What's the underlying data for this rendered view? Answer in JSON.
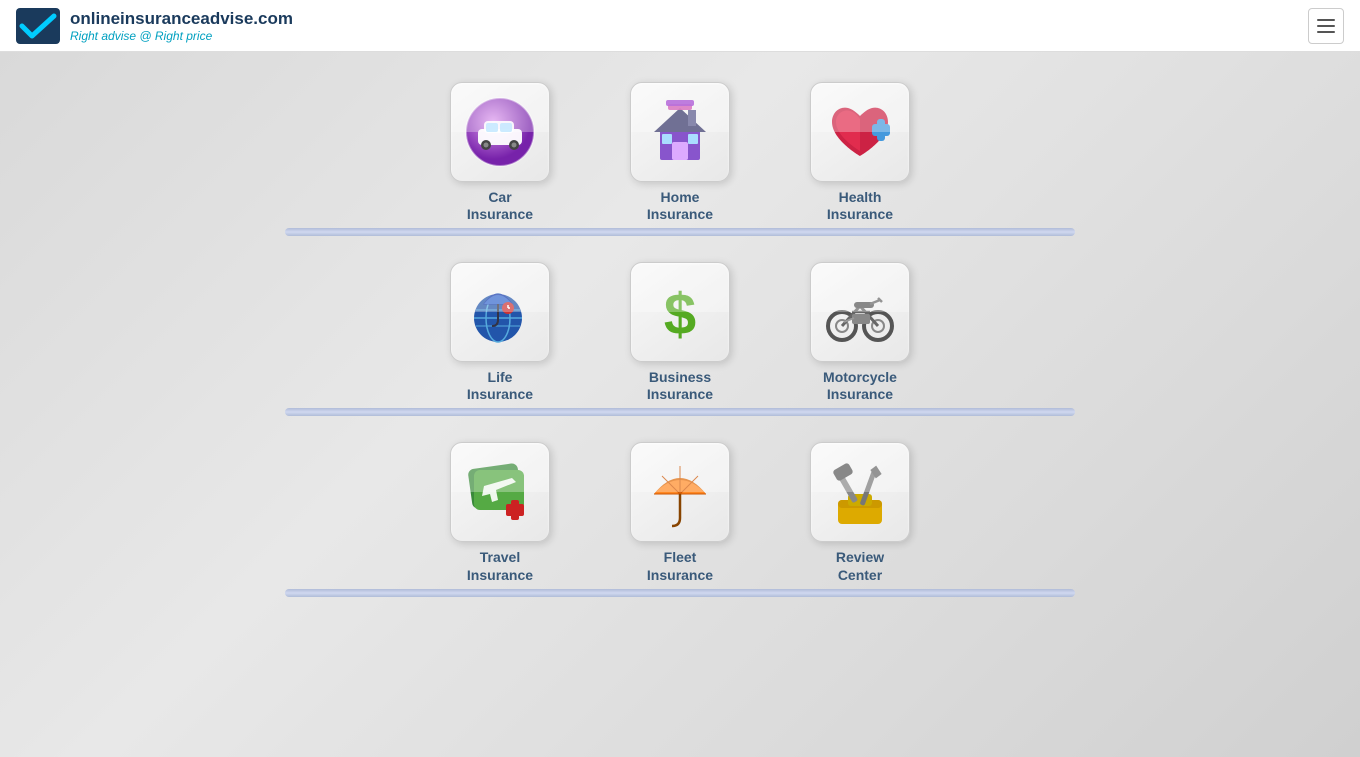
{
  "header": {
    "logo_title": "onlineinsuranceadvise.com",
    "logo_subtitle": "Right advise @ Right price",
    "hamburger_label": "Menu"
  },
  "rows": [
    {
      "id": "row1",
      "cards": [
        {
          "id": "car",
          "line1": "Car",
          "line2": "Insurance",
          "icon": "car"
        },
        {
          "id": "home",
          "line1": "Home",
          "line2": "Insurance",
          "icon": "home"
        },
        {
          "id": "health",
          "line1": "Health",
          "line2": "Insurance",
          "icon": "health"
        }
      ]
    },
    {
      "id": "row2",
      "cards": [
        {
          "id": "life",
          "line1": "Life",
          "line2": "Insurance",
          "icon": "life"
        },
        {
          "id": "business",
          "line1": "Business",
          "line2": "Insurance",
          "icon": "business"
        },
        {
          "id": "motorcycle",
          "line1": "Motorcycle",
          "line2": "Insurance",
          "icon": "motorcycle"
        }
      ]
    },
    {
      "id": "row3",
      "cards": [
        {
          "id": "travel",
          "line1": "Travel",
          "line2": "Insurance",
          "icon": "travel"
        },
        {
          "id": "fleet",
          "line1": "Fleet",
          "line2": "Insurance",
          "icon": "fleet"
        },
        {
          "id": "review",
          "line1": "Review",
          "line2": "Center",
          "icon": "review"
        }
      ]
    }
  ]
}
